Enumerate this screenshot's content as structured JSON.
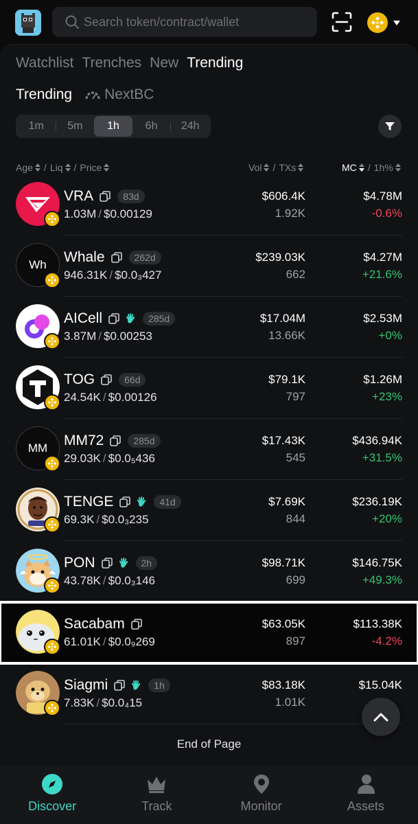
{
  "header": {
    "search_placeholder": "Search token/contract/wallet",
    "accent_color": "#f0b90b"
  },
  "nav_tabs": [
    {
      "label": "Watchlist",
      "active": false
    },
    {
      "label": "Trenches",
      "active": false
    },
    {
      "label": "New",
      "active": false
    },
    {
      "label": "Trending",
      "active": true
    }
  ],
  "sub_tabs": {
    "trending": "Trending",
    "nextbc": "NextBC"
  },
  "time_filters": [
    "1m",
    "5m",
    "1h",
    "6h",
    "24h"
  ],
  "time_filter_selected": "1h",
  "columns": {
    "age": "Age",
    "liq": "Liq",
    "price": "Price",
    "vol": "Vol",
    "txs": "TXs",
    "mc": "MC",
    "change": "1h%"
  },
  "tokens": [
    {
      "name": "VRA",
      "age": "83d",
      "liq": "1.03M",
      "price": "$0.00129",
      "vol": "$606.4K",
      "txs": "1.92K",
      "mc": "$4.78M",
      "change": "-0.6%",
      "trend": "down",
      "hand": false,
      "avatar": "vra-logo",
      "avatar_text": ""
    },
    {
      "name": "Whale",
      "age": "262d",
      "liq": "946.31K",
      "price": "$0.0₃427",
      "vol": "$239.03K",
      "txs": "662",
      "mc": "$4.27M",
      "change": "+21.6%",
      "trend": "up",
      "hand": false,
      "avatar": "text",
      "avatar_text": "Wh"
    },
    {
      "name": "AICell",
      "age": "285d",
      "liq": "3.87M",
      "price": "$0.00253",
      "vol": "$17.04M",
      "txs": "13.66K",
      "mc": "$2.53M",
      "change": "+0%",
      "trend": "up",
      "hand": true,
      "avatar": "aicell-logo",
      "avatar_text": ""
    },
    {
      "name": "TOG",
      "age": "66d",
      "liq": "24.54K",
      "price": "$0.00126",
      "vol": "$79.1K",
      "txs": "797",
      "mc": "$1.26M",
      "change": "+23%",
      "trend": "up",
      "hand": false,
      "avatar": "tog-logo",
      "avatar_text": ""
    },
    {
      "name": "MM72",
      "age": "285d",
      "liq": "29.03K",
      "price": "$0.0₅436",
      "vol": "$17.43K",
      "txs": "545",
      "mc": "$436.94K",
      "change": "+31.5%",
      "trend": "up",
      "hand": false,
      "avatar": "text",
      "avatar_text": "MM"
    },
    {
      "name": "TENGE",
      "age": "41d",
      "liq": "69.3K",
      "price": "$0.0₃235",
      "vol": "$7.69K",
      "txs": "844",
      "mc": "$236.19K",
      "change": "+20%",
      "trend": "up",
      "hand": true,
      "avatar": "tenge-portrait",
      "avatar_text": ""
    },
    {
      "name": "PON",
      "age": "2h",
      "liq": "43.78K",
      "price": "$0.0₃146",
      "vol": "$98.71K",
      "txs": "699",
      "mc": "$146.75K",
      "change": "+49.3%",
      "trend": "up",
      "hand": true,
      "avatar": "pon-dog",
      "avatar_text": ""
    },
    {
      "name": "Sacabam",
      "age": "",
      "liq": "61.01K",
      "price": "$0.0₉269",
      "vol": "$63.05K",
      "txs": "897",
      "mc": "$113.38K",
      "change": "-4.2%",
      "trend": "down",
      "hand": false,
      "avatar": "sacabam-fish",
      "avatar_text": "",
      "highlighted": true
    },
    {
      "name": "Siagmi",
      "age": "1h",
      "liq": "7.83K",
      "price": "$0.0₄15",
      "vol": "$83.18K",
      "txs": "1.01K",
      "mc": "$15.04K",
      "change": "",
      "trend": "up",
      "hand": true,
      "avatar": "siagmi-dog",
      "avatar_text": ""
    }
  ],
  "end_of_page": "End of Page",
  "bottom_nav": [
    {
      "label": "Discover",
      "icon": "compass-icon",
      "active": true
    },
    {
      "label": "Track",
      "icon": "crown-icon",
      "active": false
    },
    {
      "label": "Monitor",
      "icon": "pin-icon",
      "active": false
    },
    {
      "label": "Assets",
      "icon": "user-icon",
      "active": false
    }
  ],
  "colors": {
    "up": "#35c46e",
    "down": "#f0465a",
    "active_nav": "#3ed6c5"
  }
}
